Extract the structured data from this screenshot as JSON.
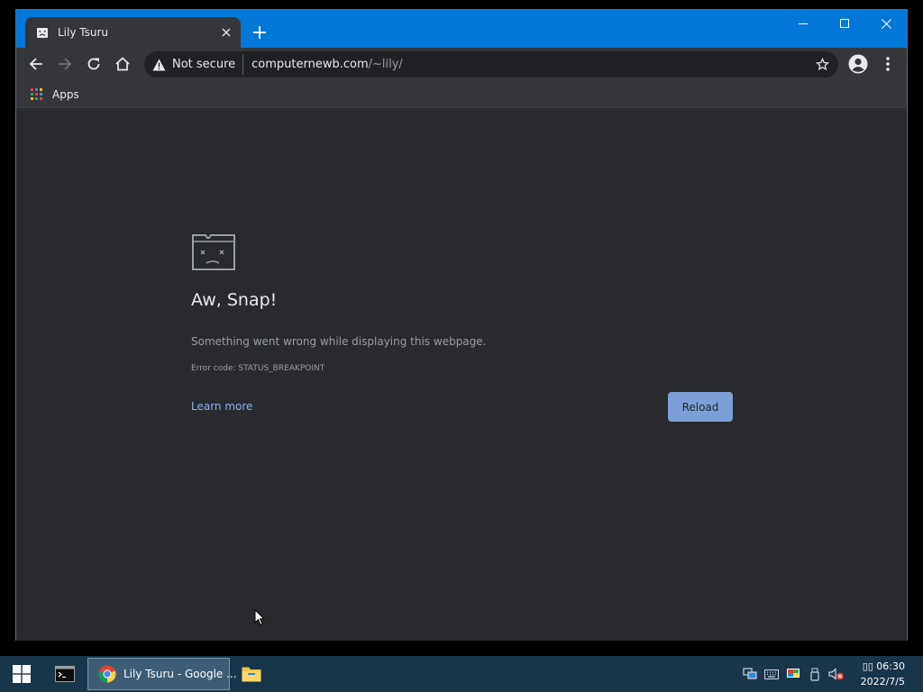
{
  "browser": {
    "tab": {
      "title": "Lily Tsuru",
      "favicon": "sad-page-icon",
      "close_icon": "close-icon"
    },
    "new_tab_icon": "plus-icon",
    "window_controls": [
      "minimize-icon",
      "maximize-icon",
      "close-icon"
    ],
    "toolbar": {
      "back_icon": "back-arrow-icon",
      "forward_icon": "forward-arrow-icon",
      "reload_icon": "reload-icon",
      "home_icon": "home-icon",
      "security_label": "Not secure",
      "url_host": "computernewb.com",
      "url_path": "/~lily/",
      "bookmark_icon": "star-icon",
      "profile_icon": "avatar-icon",
      "menu_icon": "kebab-menu-icon"
    },
    "bookmarks_bar": {
      "apps_label": "Apps"
    }
  },
  "error_page": {
    "heading": "Aw, Snap!",
    "message": "Something went wrong while displaying this webpage.",
    "error_code": "Error code: STATUS_BREAKPOINT",
    "learn_more": "Learn more",
    "reload_label": "Reload"
  },
  "taskbar": {
    "chrome_label": "Lily Tsuru - Google ...",
    "clock_time": "▯▯ 06:30",
    "clock_date": "2022/7/5"
  },
  "colors": {
    "titlebar": "#0078d7",
    "toolbar": "#35363a",
    "content": "#292a2d",
    "link": "#8ab4f8",
    "taskbar": "#193549"
  }
}
